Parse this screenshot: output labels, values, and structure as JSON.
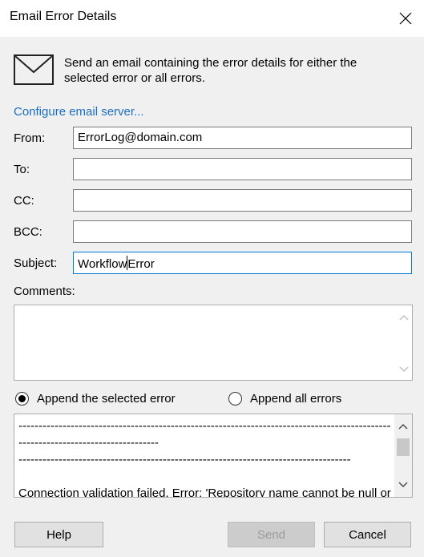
{
  "window": {
    "title": "Email Error Details"
  },
  "intro": {
    "text": "Send an email containing the error details for either the selected error or all errors."
  },
  "configure_link": "Configure email server...",
  "fields": {
    "from": {
      "label": "From:",
      "value": "ErrorLog@domain.com"
    },
    "to": {
      "label": "To:",
      "value": ""
    },
    "cc": {
      "label": "CC:",
      "value": ""
    },
    "bcc": {
      "label": "BCC:",
      "value": ""
    },
    "subject": {
      "label": "Subject:",
      "value_before_caret": "Workflow",
      "value_after_caret": "Error"
    }
  },
  "comments": {
    "label": "Comments:",
    "value": ""
  },
  "append_options": [
    {
      "label": "Append the selected error",
      "selected": true
    },
    {
      "label": "Append all errors",
      "selected": false
    }
  ],
  "error_preview": {
    "text": "--------------------------------------------------------------------------------------------------------------------------------\n-----------------------------------------------------------------------------------\n\nConnection validation failed. Error: 'Repository name cannot be null or empty."
  },
  "buttons": {
    "help": "Help",
    "send": "Send",
    "cancel": "Cancel"
  },
  "icons": [
    "close-icon",
    "mail-icon",
    "scroll-up-icon",
    "scroll-down-icon"
  ],
  "colors": {
    "link": "#1a6fc1",
    "focus_border": "#0078d7",
    "dialog_bg": "#f0f0f0"
  }
}
